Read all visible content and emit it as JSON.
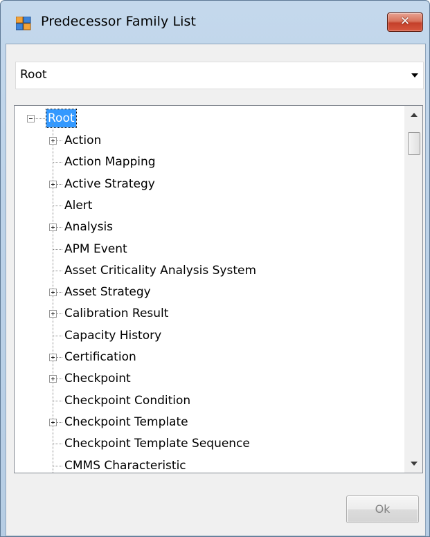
{
  "window": {
    "title": "Predecessor Family List",
    "close_glyph": "✕"
  },
  "combo": {
    "value": "Root"
  },
  "tree": {
    "root": "Root",
    "items": [
      {
        "label": "Action",
        "expandable": true
      },
      {
        "label": "Action Mapping",
        "expandable": false
      },
      {
        "label": "Active Strategy",
        "expandable": true
      },
      {
        "label": "Alert",
        "expandable": false
      },
      {
        "label": "Analysis",
        "expandable": true
      },
      {
        "label": "APM Event",
        "expandable": false
      },
      {
        "label": "Asset Criticality Analysis System",
        "expandable": false
      },
      {
        "label": "Asset Strategy",
        "expandable": true
      },
      {
        "label": "Calibration Result",
        "expandable": true
      },
      {
        "label": "Capacity History",
        "expandable": false
      },
      {
        "label": "Certification",
        "expandable": true
      },
      {
        "label": "Checkpoint",
        "expandable": true
      },
      {
        "label": "Checkpoint Condition",
        "expandable": false
      },
      {
        "label": "Checkpoint Template",
        "expandable": true
      },
      {
        "label": "Checkpoint Template Sequence",
        "expandable": false
      },
      {
        "label": "CMMS Characteristic",
        "expandable": false
      }
    ]
  },
  "buttons": {
    "ok_label": "Ok"
  },
  "icons": {
    "app": "app-window-icon",
    "dropdown": "chevron-down-icon",
    "scroll_up": "scroll-up-icon",
    "scroll_down": "scroll-down-icon"
  },
  "colors": {
    "selection": "#3399ff",
    "close_button": "#c74a33",
    "titlebar": "#bfd4ea"
  }
}
